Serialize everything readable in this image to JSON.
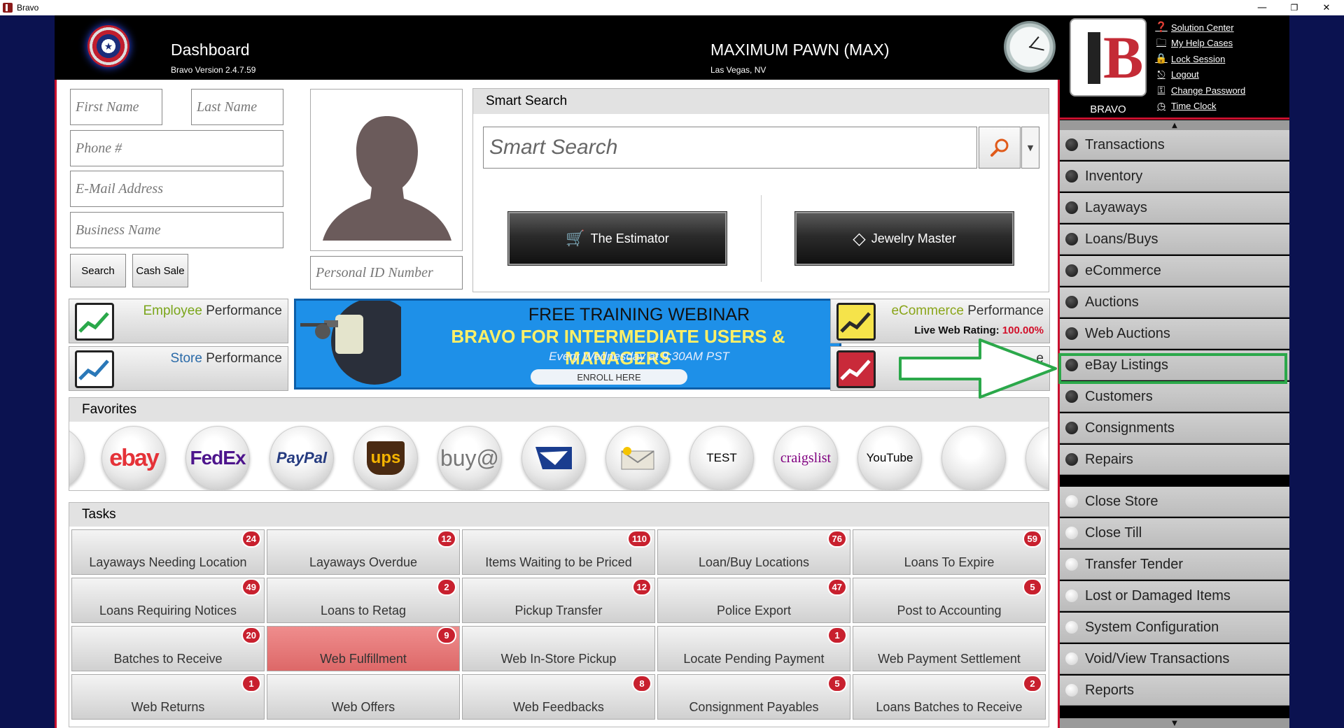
{
  "window": {
    "title": "Bravo",
    "minimize": "—",
    "restore": "❐",
    "close": "✕"
  },
  "header": {
    "dashboard_title": "Dashboard",
    "version": "Bravo Version 2.4.7.59",
    "store_name": "MAXIMUM PAWN (MAX)",
    "store_location": "Las Vegas, NV",
    "brand_label": "BRAVO",
    "brand_letter": "B",
    "links": [
      "Solution Center",
      "My Help Cases",
      "Lock Session",
      "Logout",
      "Change Password",
      "Time Clock"
    ]
  },
  "customer": {
    "first_name_placeholder": "First Name",
    "last_name_placeholder": "Last Name",
    "phone_placeholder": "Phone #",
    "email_placeholder": "E-Mail Address",
    "business_placeholder": "Business Name",
    "personal_id_placeholder": "Personal ID Number",
    "search_label": "Search",
    "cash_sale_label": "Cash Sale"
  },
  "smart_search": {
    "title": "Smart Search",
    "placeholder": "Smart Search",
    "estimator_label": "The Estimator",
    "jewelry_label": "Jewelry Master"
  },
  "performance": {
    "employee_highlight": "Employee",
    "employee_rest": "Performance",
    "store_highlight": "Store",
    "store_rest": "Performance",
    "ecommerce_highlight": "eCommerce",
    "ecommerce_rest": "Performance",
    "live_rating_label": "Live Web Rating:",
    "live_rating_value": "100.00%",
    "fourth_tile_fragment": "e"
  },
  "banner": {
    "line1": "FREE TRAINING WEBINAR",
    "line2": "BRAVO FOR INTERMEDIATE USERS & MANAGERS",
    "line3": "Every Wednesday at 9:30AM PST",
    "button": "ENROLL HERE"
  },
  "favorites": {
    "title": "Favorites",
    "items": [
      "ebay",
      "FedEx",
      "PayPal",
      "ups",
      "buy@",
      "usps",
      "mail",
      "TEST",
      "craigslist",
      "YouTube",
      "",
      ""
    ]
  },
  "tasks": {
    "title": "Tasks",
    "items": [
      {
        "label": "Layaways Needing Location",
        "count": "24"
      },
      {
        "label": "Layaways Overdue",
        "count": "12"
      },
      {
        "label": "Items Waiting to be Priced",
        "count": "110"
      },
      {
        "label": "Loan/Buy Locations",
        "count": "76"
      },
      {
        "label": "Loans To Expire",
        "count": "59"
      },
      {
        "label": "Loans Requiring Notices",
        "count": "49"
      },
      {
        "label": "Loans to Retag",
        "count": "2"
      },
      {
        "label": "Pickup Transfer",
        "count": "12"
      },
      {
        "label": "Police Export",
        "count": "47"
      },
      {
        "label": "Post to Accounting",
        "count": "5"
      },
      {
        "label": "Batches to Receive",
        "count": "20"
      },
      {
        "label": "Web Fulfillment",
        "count": "9"
      },
      {
        "label": "Web In-Store Pickup",
        "count": ""
      },
      {
        "label": "Locate Pending Payment",
        "count": "1"
      },
      {
        "label": "Web Payment Settlement",
        "count": ""
      },
      {
        "label": "Web Returns",
        "count": "1"
      },
      {
        "label": "Web Offers",
        "count": ""
      },
      {
        "label": "Web Feedbacks",
        "count": "8"
      },
      {
        "label": "Consignment Payables",
        "count": "5"
      },
      {
        "label": "Loans Batches to Receive",
        "count": "2"
      }
    ]
  },
  "sidebar": {
    "modules": [
      "Transactions",
      "Inventory",
      "Layaways",
      "Loans/Buys",
      "eCommerce",
      "Auctions",
      "Web Auctions",
      "eBay Listings",
      "Customers",
      "Consignments",
      "Repairs"
    ],
    "admin": [
      "Close Store",
      "Close Till",
      "Transfer Tender",
      "Lost or Damaged Items",
      "System Configuration",
      "Void/View Transactions",
      "Reports"
    ],
    "highlighted": "eBay Listings"
  },
  "colors": {
    "accent_red": "#c8102e",
    "annotation_green": "#2ba84a",
    "badge_red": "#c8202e",
    "banner_blue": "#1e90e8"
  }
}
